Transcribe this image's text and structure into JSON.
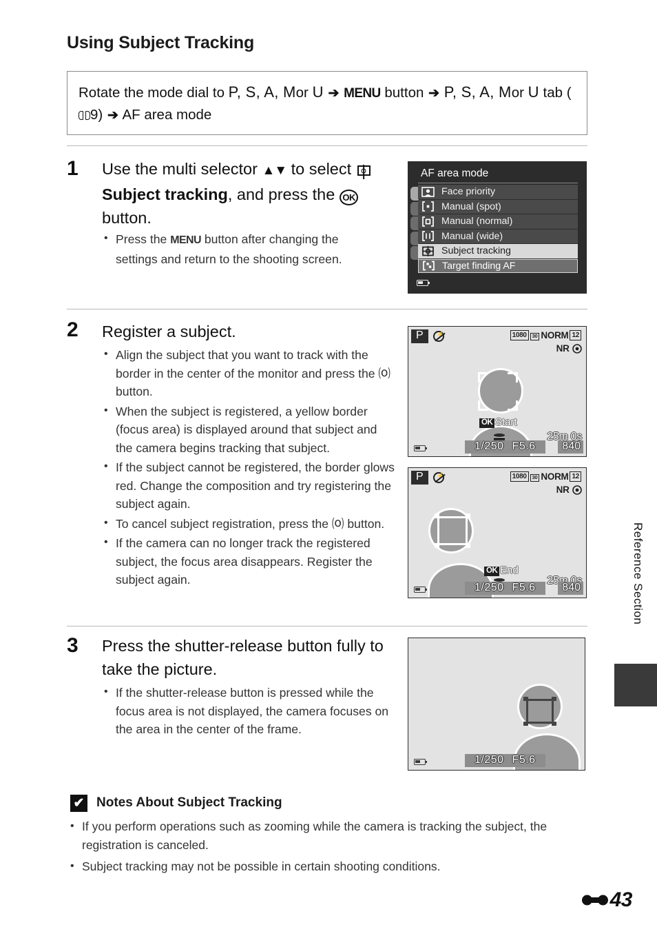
{
  "page": {
    "title": "Using Subject Tracking",
    "side_tab_label": "Reference Section",
    "page_number": "43",
    "page_prefix_icon": "e-mark-icon"
  },
  "path_box": {
    "line1_pre": "Rotate the mode dial to",
    "modes_1": "P, S, A, M",
    "or_1": "or",
    "mode_u_1": "U",
    "arrow": "➔",
    "menu_button": "MENU",
    "button_word": "button",
    "modes_2": "P, S, A, M",
    "or_2": "or",
    "mode_u_2": "U",
    "tab_word": "tab",
    "ref_open": "(",
    "ref_page": "9)",
    "final": "AF area mode"
  },
  "steps": [
    {
      "number": "1",
      "head_pre": "Use the multi selector",
      "head_arrows": "▲▼",
      "head_mid": "to select",
      "head_bold": "Subject tracking",
      "head_post": ", and press the",
      "head_end": "button.",
      "bullets": [
        {
          "pre": "Press the",
          "chip": "MENU",
          "post": "button after changing the settings and return to the shooting screen."
        }
      ]
    },
    {
      "number": "2",
      "head": "Register a subject.",
      "bullets": [
        "Align the subject that you want to track with the border in the center of the monitor and press the ⒪ button.",
        "When the subject is registered, a yellow border (focus area) is displayed around that subject and the camera begins tracking that subject.",
        "If the subject cannot be registered, the border glows red. Change the composition and try registering the subject again.",
        "To cancel subject registration, press the ⒪ button.",
        "If the camera can no longer track the registered subject, the focus area disappears. Register the subject again."
      ]
    },
    {
      "number": "3",
      "head": "Press the shutter-release button fully to take the picture.",
      "bullets": [
        "If the shutter-release button is pressed while the focus area is not displayed, the camera focuses on the area in the center of the frame."
      ]
    }
  ],
  "af_menu": {
    "title": "AF area mode",
    "items": [
      {
        "label": "Face priority",
        "icon": "face-priority-icon",
        "state": "normal"
      },
      {
        "label": "Manual (spot)",
        "icon": "manual-spot-icon",
        "state": "normal"
      },
      {
        "label": "Manual (normal)",
        "icon": "manual-normal-icon",
        "state": "normal"
      },
      {
        "label": "Manual (wide)",
        "icon": "manual-wide-icon",
        "state": "normal"
      },
      {
        "label": "Subject tracking",
        "icon": "subject-tracking-icon",
        "state": "selected"
      },
      {
        "label": "Target finding AF",
        "icon": "target-finding-icon",
        "state": "focused"
      }
    ]
  },
  "screens": [
    {
      "id": "register-start",
      "mode_badge": "P",
      "flash_icon": "flash-off-icon",
      "movie_res": "1080",
      "frame_rate": "30",
      "quality": "NORM",
      "image_size": "12",
      "nr_label": "NR",
      "ok_chip": "OK",
      "ok_label": "Start",
      "card_icon": "memory-card-icon",
      "rec_time": "25m 0s",
      "shots_remaining": "840",
      "shutter_speed": "1/250",
      "aperture": "F5.6",
      "battery_icon": "battery-icon",
      "focus_style": "corner-brackets"
    },
    {
      "id": "register-end",
      "mode_badge": "P",
      "flash_icon": "flash-off-icon",
      "movie_res": "1080",
      "frame_rate": "30",
      "quality": "NORM",
      "image_size": "12",
      "nr_label": "NR",
      "ok_chip": "OK",
      "ok_label": "End",
      "card_icon": "memory-card-icon",
      "rec_time": "25m 0s",
      "shots_remaining": "840",
      "shutter_speed": "1/250",
      "aperture": "F5.6",
      "battery_icon": "battery-icon",
      "focus_style": "tracking-frame"
    },
    {
      "id": "shutter-release",
      "shutter_speed": "1/250",
      "aperture": "F5.6",
      "battery_icon": "battery-icon",
      "focus_style": "dark-frame"
    }
  ],
  "notes": {
    "mark": "✔",
    "title": "Notes About Subject Tracking",
    "bullets": [
      "If you perform operations such as zooming while the camera is tracking the subject, the registration is canceled.",
      "Subject tracking may not be possible in certain shooting conditions."
    ]
  }
}
